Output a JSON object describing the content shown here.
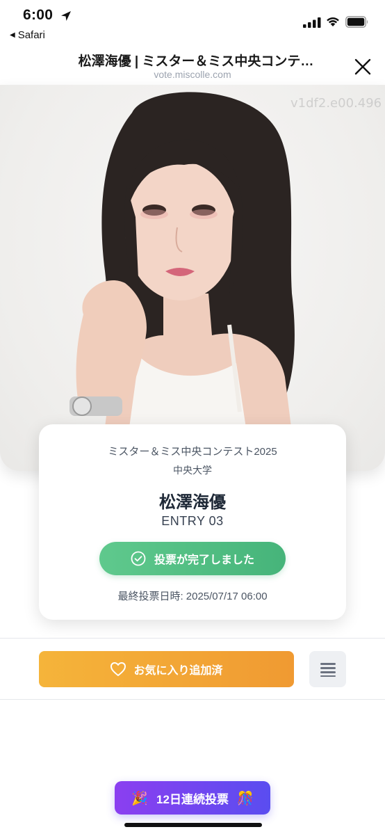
{
  "status_bar": {
    "time": "6:00",
    "back_app": "Safari",
    "icons": [
      "location-arrow-icon",
      "cellular-signal-icon",
      "wifi-icon",
      "battery-icon"
    ]
  },
  "header": {
    "title": "松澤海優 | ミスター＆ミス中央コンテ…",
    "url": "vote.miscolle.com",
    "close_icon": "close-icon"
  },
  "photo": {
    "watermark": "v1df2.e00.496",
    "description_icon": "portrait-photo"
  },
  "profile": {
    "contest": "ミスター＆ミス中央コンテスト2025",
    "university": "中央大学",
    "name": "松澤海優",
    "entry": "ENTRY 03",
    "vote_button": "投票が完了しました",
    "last_vote": "最終投票日時: 2025/07/17 06:00"
  },
  "actions": {
    "favorite_label": "お気に入り追加済",
    "menu_icon": "menu-icon"
  },
  "streak": {
    "label": "12日連続投票",
    "left_emoji": "🎉",
    "right_emoji": "🎊"
  },
  "colors": {
    "vote_green": "#4fbd82",
    "favorite_orange": "#f3a836",
    "streak_purple": "#7346f0"
  }
}
